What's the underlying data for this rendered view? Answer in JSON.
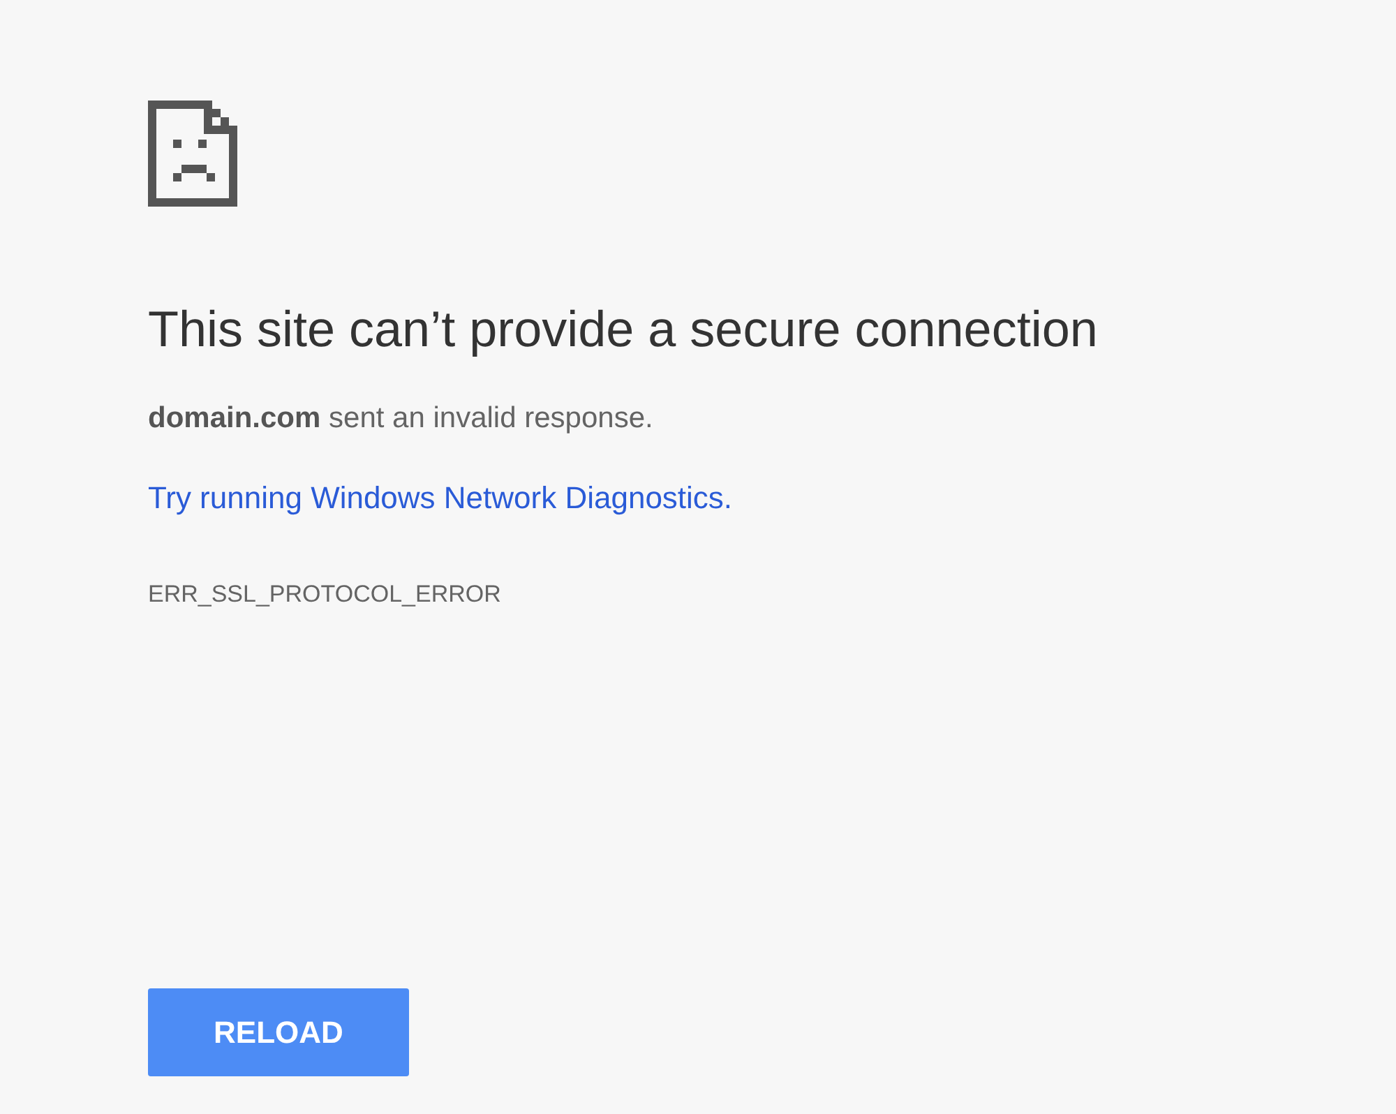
{
  "heading": "This site can’t provide a secure connection",
  "message": "**domain.com** sent an invalid response.",
  "link": "Try running Windows Network Diagnostics.",
  "error_code": "ERR_SSL_PROTOCOL_ERROR",
  "button": "RELOAD"
}
